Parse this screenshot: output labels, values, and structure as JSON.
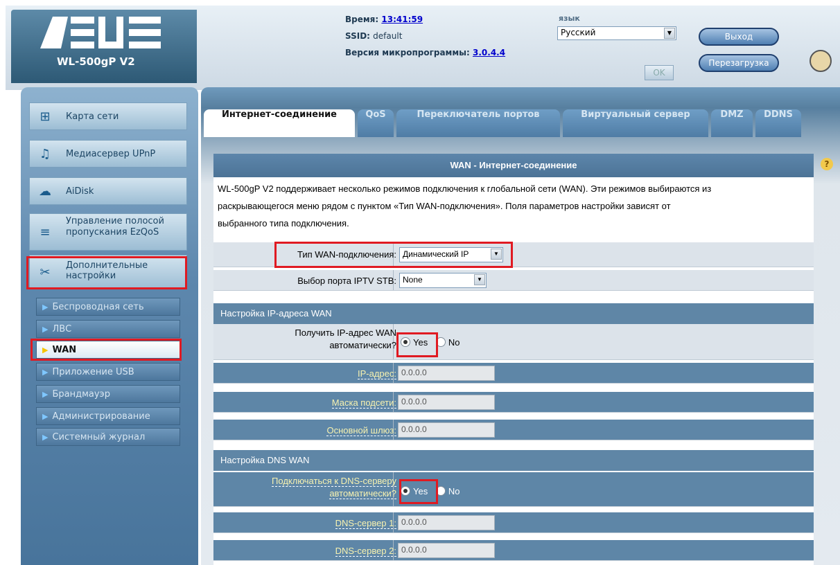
{
  "header": {
    "brand": "ASUS",
    "model": "WL-500gP V2",
    "time_label": "Время:",
    "time_value": "13:41:59",
    "ssid_label": "SSID:",
    "ssid_value": "default",
    "firmware_label": "Версия микропрограммы:",
    "firmware_value": "3.0.4.4",
    "language_label": "язык",
    "language_value": "Русский",
    "ok_label": "OK",
    "logout_label": "Выход",
    "reboot_label": "Перезагрузка"
  },
  "sidebar": {
    "items": [
      {
        "label": "Карта сети",
        "icon": "network-map-icon"
      },
      {
        "label": "Медиасервер UPnP",
        "icon": "media-server-icon"
      },
      {
        "label": "AiDisk",
        "icon": "aidisk-icon"
      },
      {
        "label": "Управление полосой пропускания EzQoS",
        "icon": "ezqos-icon"
      },
      {
        "label": "Дополнительные настройки",
        "icon": "advanced-settings-icon"
      }
    ],
    "sub_items": [
      {
        "label": "Беспроводная сеть"
      },
      {
        "label": "ЛВС"
      },
      {
        "label": "WAN"
      },
      {
        "label": "Приложение USB"
      },
      {
        "label": "Брандмауэр"
      },
      {
        "label": "Администрирование"
      },
      {
        "label": "Системный журнал"
      }
    ]
  },
  "tabs": [
    {
      "label": "Интернет-соединение"
    },
    {
      "label": "QoS"
    },
    {
      "label": "Переключатель портов"
    },
    {
      "label": "Виртуальный сервер"
    },
    {
      "label": "DMZ"
    },
    {
      "label": "DDNS"
    }
  ],
  "main": {
    "title": "WAN - Интернет-соединение",
    "description_lines": [
      "WL-500gP V2 поддерживает несколько режимов подключения к глобальной сети (WAN). Эти режимов выбираются из",
      "раскрывающегося меню рядом с пунктом «Тип WAN-подключения». Поля параметров настройки зависят от",
      "выбранного типа подключения."
    ],
    "wan_type_label": "Тип WAN-подключения:",
    "wan_type_value": "Динамический IP",
    "iptv_label": "Выбор порта IPTV STB:",
    "iptv_value": "None",
    "ip_section_title": "Настройка IP-адреса WAN",
    "auto_ip_label_1": "Получить IP-адрес WAN",
    "auto_ip_label_2": "автоматически?",
    "yes": "Yes",
    "no": "No",
    "ip_label": "IP-адрес:",
    "ip_value": "0.0.0.0",
    "mask_label": "Маска подсети:",
    "mask_value": "0.0.0.0",
    "gateway_label": "Основной шлюз:",
    "gateway_value": "0.0.0.0",
    "dns_section_title": "Настройка DNS WAN",
    "dns_auto_label_1": "Подключаться к DNS-серверу",
    "dns_auto_label_2": "автоматически?",
    "dns1_label": "DNS-сервер 1:",
    "dns1_value": "0.0.0.0",
    "dns2_label": "DNS-сервер 2:",
    "dns2_value": "0.0.0.0"
  },
  "colors": {
    "accent": "#4c7396",
    "highlight_box": "#e01a22",
    "active_arrow": "#f5c400"
  }
}
